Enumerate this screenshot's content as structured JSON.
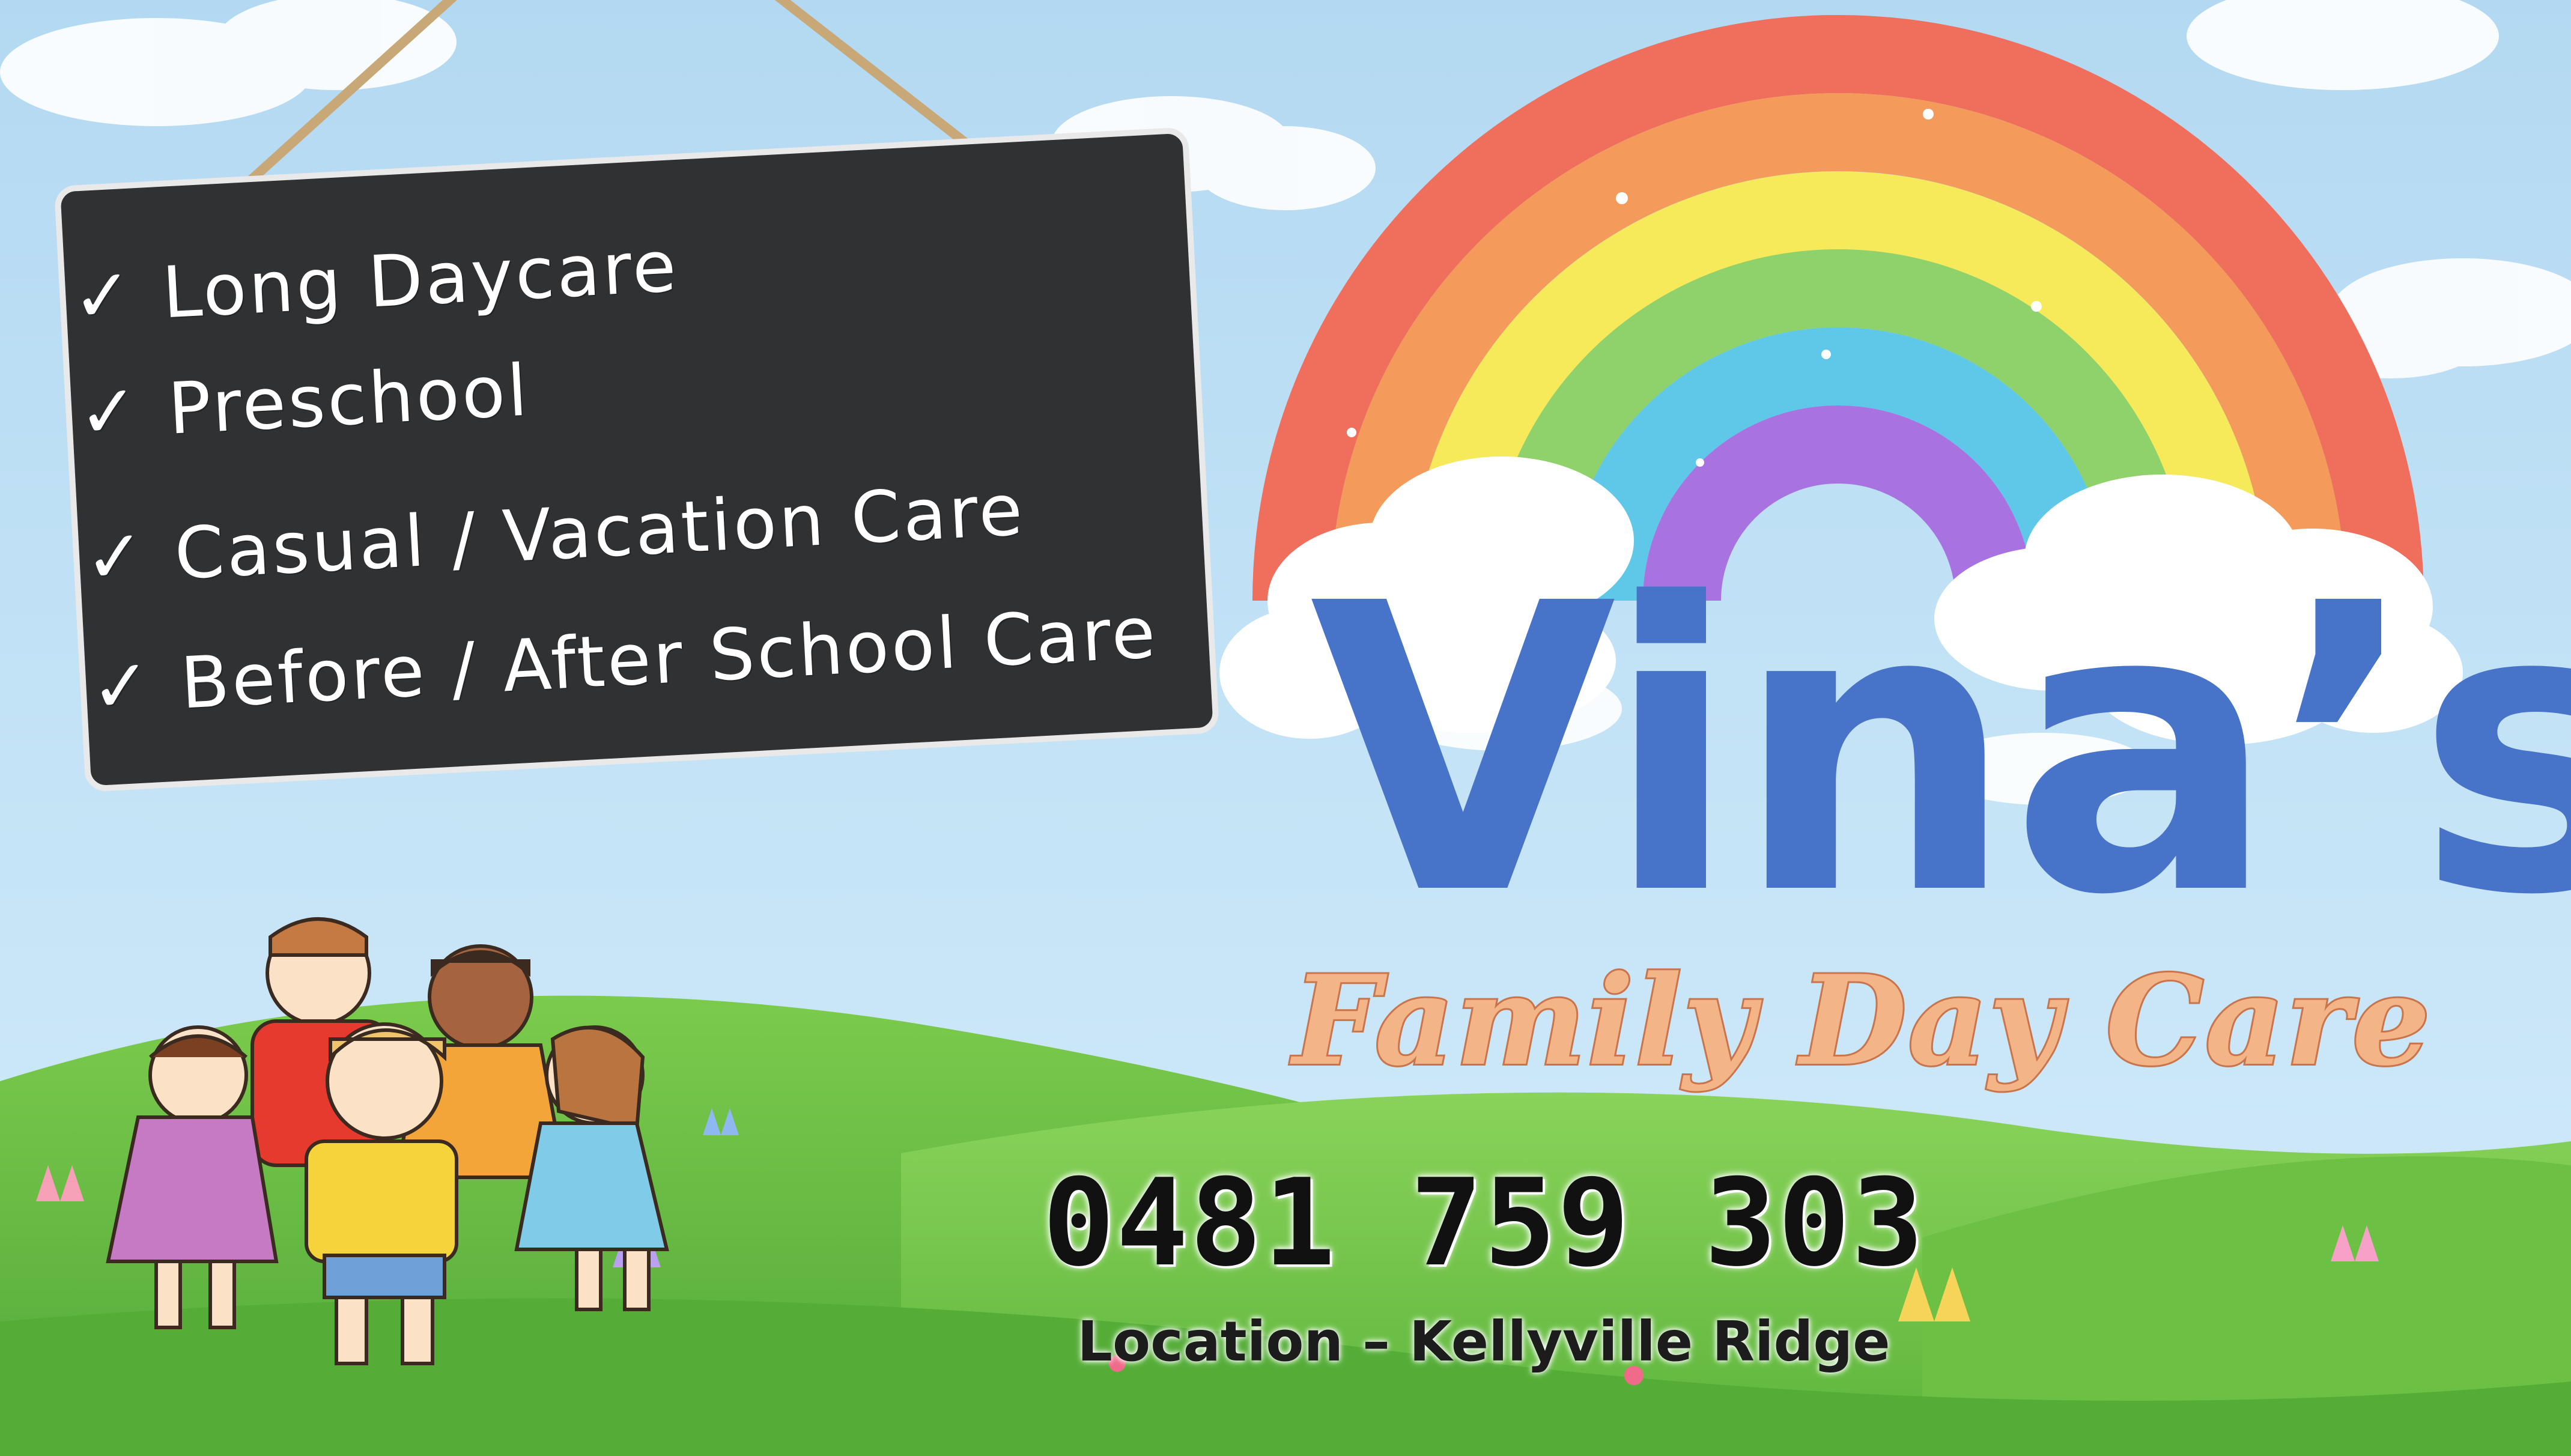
{
  "services": {
    "items": [
      {
        "label": "Long Daycare"
      },
      {
        "label": "Preschool"
      },
      {
        "label": "Casual / Vacation Care"
      },
      {
        "label": "Before / After School Care"
      }
    ],
    "check_icon": "checkmark-icon"
  },
  "brand": {
    "name": "Vina’s",
    "tagline": "Family Day Care"
  },
  "contact": {
    "phone": "0481 759 303",
    "location": "Location – Kellyville Ridge"
  },
  "colors": {
    "sky": "#bfe1f5",
    "grass": "#6cc144",
    "chalkboard": "#2f3133",
    "brand_blue": "#4774c8",
    "tagline_peach": "#f3b487",
    "rainbow": [
      "#ef6e5c",
      "#f49a5a",
      "#f6e95a",
      "#8fd16a",
      "#5fc8e8",
      "#a873e0"
    ]
  }
}
